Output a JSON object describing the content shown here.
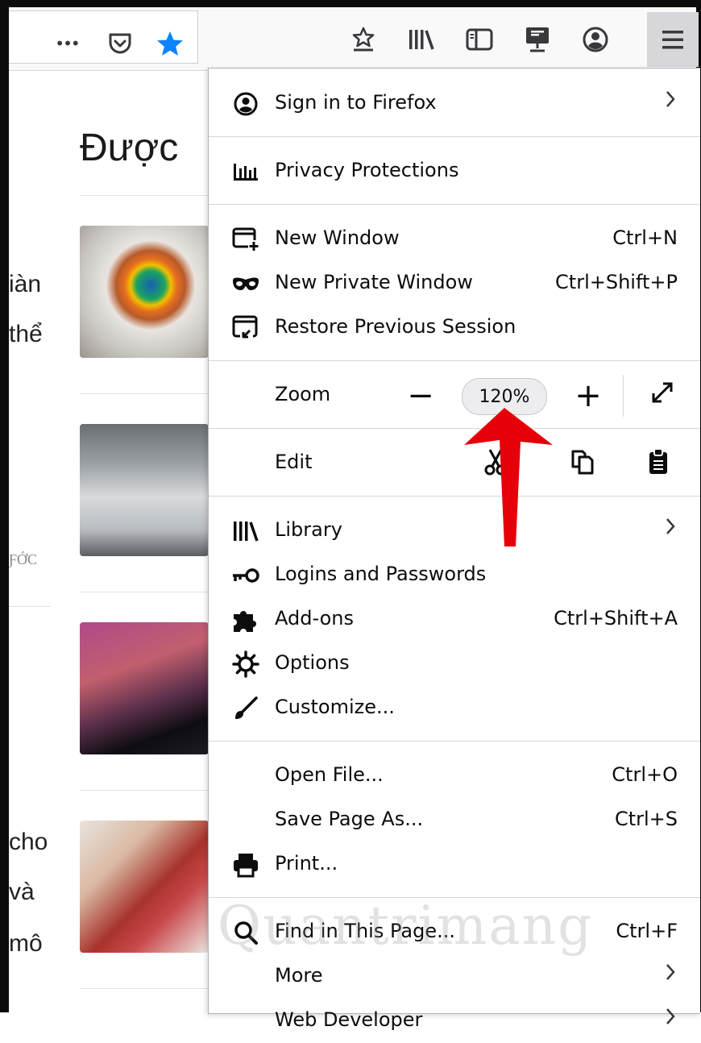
{
  "toolbar": {
    "icons": [
      "more-icon",
      "pocket-icon",
      "bookmark-star-icon",
      "bookmarks-menu-icon",
      "library-icon",
      "sidebar-icon",
      "screenshot-icon",
      "account-icon",
      "hamburger-menu-icon"
    ],
    "more_glyph": "•••"
  },
  "page": {
    "heading": "Được",
    "side_texts": [
      "iàn",
      "thể",
      "ƑỚC",
      "cho",
      "và",
      "mô"
    ]
  },
  "menu": {
    "sign_in": "Sign in to Firefox",
    "privacy": "Privacy Protections",
    "new_window": {
      "label": "New Window",
      "shortcut": "Ctrl+N"
    },
    "new_private": {
      "label": "New Private Window",
      "shortcut": "Ctrl+Shift+P"
    },
    "restore": "Restore Previous Session",
    "zoom": {
      "label": "Zoom",
      "minus": "−",
      "value": "120%",
      "plus": "+"
    },
    "edit": {
      "label": "Edit"
    },
    "library": "Library",
    "logins": "Logins and Passwords",
    "addons": {
      "label": "Add-ons",
      "shortcut": "Ctrl+Shift+A"
    },
    "options": "Options",
    "customize": "Customize...",
    "open_file": {
      "label": "Open File...",
      "shortcut": "Ctrl+O"
    },
    "save_page": {
      "label": "Save Page As...",
      "shortcut": "Ctrl+S"
    },
    "print": "Print...",
    "find": {
      "label": "Find in This Page...",
      "shortcut": "Ctrl+F"
    },
    "more": "More",
    "web_developer": "Web Developer"
  },
  "watermark": "Quantrimang",
  "colors": {
    "accent_star": "#0a84ff",
    "arrow": "#e5000a",
    "menu_button_bg": "#d7d7db"
  }
}
